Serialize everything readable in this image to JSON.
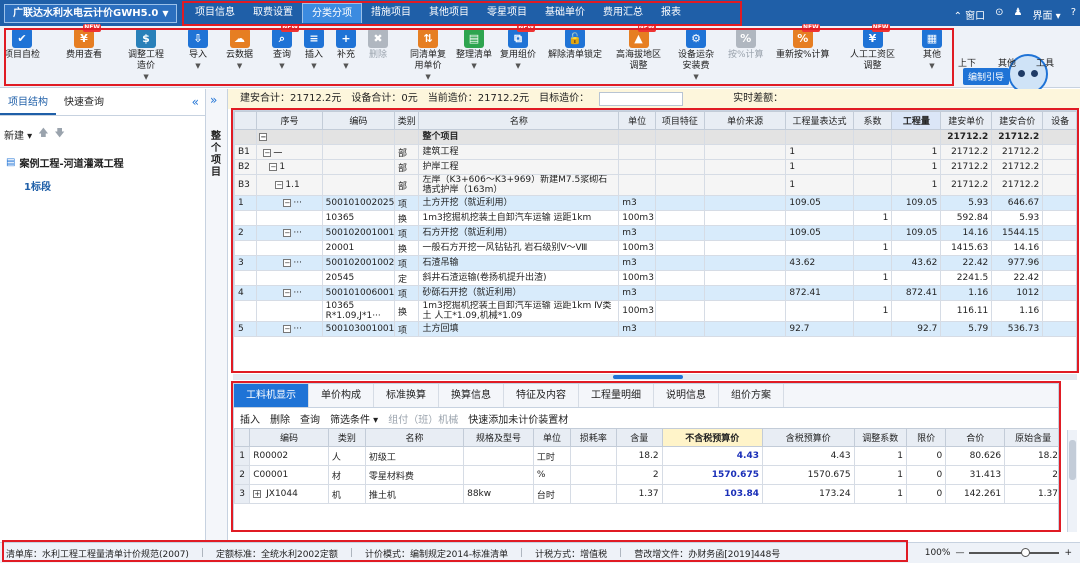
{
  "titlebar": {
    "app_name": "广联达水利水电云计价GWH5.0",
    "tabs": [
      "项目信息",
      "取费设置",
      "分类分项",
      "措施项目",
      "其他项目",
      "零星项目",
      "基础单价",
      "费用汇总",
      "报表"
    ],
    "active_tab": "分类分项",
    "right": [
      "窗口",
      "界面"
    ]
  },
  "ribbon": {
    "buttons": [
      {
        "label": "项目自检",
        "color": "#1f73d6",
        "glyph": "✔"
      },
      {
        "label": "费用查看",
        "color": "#e67e22",
        "glyph": "¥",
        "new": true
      },
      {
        "label": "调整工程\n造价",
        "color": "#2980b9",
        "glyph": "$",
        "caret": true
      },
      {
        "label": "导入",
        "color": "#1f73d6",
        "glyph": "⇩",
        "caret": true
      },
      {
        "label": "云数据",
        "color": "#e67e22",
        "glyph": "☁",
        "caret": true
      },
      {
        "label": "查询",
        "color": "#1f73d6",
        "glyph": "⌕",
        "caret": true,
        "new": true
      },
      {
        "label": "插入",
        "color": "#1f73d6",
        "glyph": "≡",
        "caret": true
      },
      {
        "label": "补充",
        "color": "#1f73d6",
        "glyph": "+",
        "caret": true
      },
      {
        "label": "删除",
        "color": "#b0b7c0",
        "glyph": "✖",
        "disabled": true
      },
      {
        "label": "同清单复\n用单价",
        "color": "#e67e22",
        "glyph": "⇅",
        "caret": true
      },
      {
        "label": "整理清单",
        "color": "#2ea44f",
        "glyph": "▤",
        "caret": true
      },
      {
        "label": "复用组价",
        "color": "#1f73d6",
        "glyph": "⧉",
        "caret": true,
        "new": true
      },
      {
        "label": "解除清单锁定",
        "color": "#1f73d6",
        "glyph": "🔓"
      },
      {
        "label": "高海拔地区\n调整",
        "color": "#e67e22",
        "glyph": "▲",
        "new": true
      },
      {
        "label": "设备运杂\n安装费",
        "color": "#1f73d6",
        "glyph": "⚙",
        "caret": true
      },
      {
        "label": "按%计算",
        "color": "#b0b7c0",
        "glyph": "%",
        "disabled": true
      },
      {
        "label": "重新按%计算",
        "color": "#e67e22",
        "glyph": "%",
        "new": true
      },
      {
        "label": "人工工资区\n调整",
        "color": "#1f73d6",
        "glyph": "¥",
        "new": true
      },
      {
        "label": "其他",
        "color": "#1f73d6",
        "glyph": "▦",
        "caret": true
      },
      {
        "label": "上下",
        "color": "#1f73d6",
        "glyph": "⇅"
      },
      {
        "label": "其他",
        "color": "#1f73d6",
        "glyph": "▦"
      },
      {
        "label": "工具",
        "color": "#1f73d6",
        "glyph": "✎",
        "caret": true
      }
    ],
    "guide_label": "编制引导"
  },
  "left_panel": {
    "tabs": [
      "项目结构",
      "快速查询"
    ],
    "toolbar_new": "新建",
    "tree_root": "案例工程-河道灌溉工程",
    "tree_child": "1标段"
  },
  "vertical_label": "整个项目",
  "summary": {
    "build_total": "建安合计：21712.2元",
    "equip_total": "设备合计：0元",
    "current_price": "当前造价：21712.2元",
    "target_label": "目标造价：",
    "realtime_diff": "实时差额："
  },
  "main_grid": {
    "headers": [
      "序号",
      "编码",
      "类别",
      "名称",
      "单位",
      "项目特征",
      "单价来源",
      "工程量表达式",
      "系数",
      "工程量",
      "建安单价",
      "建安合价",
      "设备"
    ],
    "highlight_header": "工程量",
    "rows": [
      {
        "kind": "root",
        "no": "",
        "tree": "−",
        "code": "",
        "type": "",
        "name": "整个项目",
        "unit": "",
        "expr": "",
        "coef": "",
        "qty": "",
        "price": "21712.2",
        "total": "21712.2"
      },
      {
        "kind": "section",
        "no": "B1",
        "tree": "− 一",
        "code": "",
        "type": "部",
        "name": "建筑工程",
        "unit": "",
        "expr": "1",
        "coef": "",
        "qty": "1",
        "price": "21712.2",
        "total": "21712.2"
      },
      {
        "kind": "section",
        "no": "B2",
        "tree": "− 1",
        "code": "",
        "type": "部",
        "name": "护岸工程",
        "unit": "",
        "expr": "1",
        "coef": "",
        "qty": "1",
        "price": "21712.2",
        "total": "21712.2"
      },
      {
        "kind": "section",
        "no": "B3",
        "tree": "− 1.1",
        "code": "",
        "type": "部",
        "name": "左岸（K3+606～K3+969）新建M7.5浆砌石墙式护岸（163m）",
        "unit": "",
        "expr": "1",
        "coef": "",
        "qty": "1",
        "price": "21712.2",
        "total": "21712.2"
      },
      {
        "kind": "item",
        "no": "1",
        "tree": "− ···",
        "code": "500101002025",
        "type": "项",
        "name": "土方开挖（就近利用）",
        "unit": "m3",
        "expr": "109.05",
        "coef": "",
        "qty": "109.05",
        "price": "5.93",
        "total": "646.67"
      },
      {
        "kind": "sub",
        "no": "",
        "tree": "",
        "code": "10365",
        "type": "换",
        "name": "1m3挖掘机挖装土自卸汽车运输 运距1km",
        "unit": "100m3",
        "expr": "",
        "coef": "1",
        "qty": "",
        "price": "592.84",
        "total": "5.93"
      },
      {
        "kind": "item",
        "no": "2",
        "tree": "− ···",
        "code": "500102001001",
        "type": "项",
        "name": "石方开挖（就近利用）",
        "unit": "m3",
        "expr": "109.05",
        "coef": "",
        "qty": "109.05",
        "price": "14.16",
        "total": "1544.15"
      },
      {
        "kind": "sub",
        "no": "",
        "tree": "",
        "code": "20001",
        "type": "换",
        "name": "一般石方开挖一风钻钻孔 岩石级别V～Ⅷ",
        "unit": "100m3",
        "expr": "",
        "coef": "1",
        "qty": "",
        "price": "1415.63",
        "total": "14.16"
      },
      {
        "kind": "item",
        "no": "3",
        "tree": "− ···",
        "code": "500102001002",
        "type": "项",
        "name": "石渣吊输",
        "unit": "m3",
        "expr": "43.62",
        "coef": "",
        "qty": "43.62",
        "price": "22.42",
        "total": "977.96"
      },
      {
        "kind": "sub",
        "no": "",
        "tree": "",
        "code": "20545",
        "type": "定",
        "name": "斜井石渣运输(卷扬机提升出渣)",
        "unit": "100m3",
        "expr": "",
        "coef": "1",
        "qty": "",
        "price": "2241.5",
        "total": "22.42"
      },
      {
        "kind": "item",
        "no": "4",
        "tree": "− ···",
        "code": "500101006001",
        "type": "项",
        "name": "砂砾石开挖（就近利用）",
        "unit": "m3",
        "expr": "872.41",
        "coef": "",
        "qty": "872.41",
        "price": "1.16",
        "total": "1012"
      },
      {
        "kind": "sub",
        "no": "",
        "tree": "",
        "code": "10365\nR*1.09,J*1···",
        "type": "换",
        "name": "1m3挖掘机挖装土自卸汽车运输 运距1km Ⅳ类土 人工*1.09,机械*1.09",
        "unit": "100m3",
        "expr": "",
        "coef": "1",
        "qty": "",
        "price": "116.11",
        "total": "1.16"
      },
      {
        "kind": "item",
        "no": "5",
        "tree": "− ···",
        "code": "500103001001",
        "type": "项",
        "name": "土方回填",
        "unit": "m3",
        "expr": "92.7",
        "coef": "",
        "qty": "92.7",
        "price": "5.79",
        "total": "536.73"
      }
    ]
  },
  "bottom_panel": {
    "tabs": [
      "工料机显示",
      "单价构成",
      "标准换算",
      "换算信息",
      "特征及内容",
      "工程量明细",
      "说明信息",
      "组价方案"
    ],
    "active_tab": "工料机显示",
    "toolbar": [
      "插入",
      "删除",
      "查询",
      "筛选条件",
      "组付（班）机械",
      "快速添加未计价装置材"
    ],
    "headers": [
      "编码",
      "类别",
      "名称",
      "规格及型号",
      "单位",
      "损耗率",
      "含量",
      "不含税预算价",
      "含税预算价",
      "调整系数",
      "限价",
      "合价",
      "原始含量"
    ],
    "rows": [
      {
        "no": "1",
        "code": "R00002",
        "type": "人",
        "name": "初级工",
        "spec": "",
        "unit": "工时",
        "loss": "",
        "content": "18.2",
        "price": "4.43",
        "taxprice": "4.43",
        "coef": "1",
        "limit": "0",
        "total": "80.626",
        "orig": "18.2"
      },
      {
        "no": "2",
        "code": "C00001",
        "type": "材",
        "name": "零星材料费",
        "spec": "",
        "unit": "%",
        "loss": "",
        "content": "2",
        "price": "1570.675",
        "taxprice": "1570.675",
        "coef": "1",
        "limit": "0",
        "total": "31.413",
        "orig": "2"
      },
      {
        "no": "3",
        "code": "JX1044",
        "type": "机",
        "name": "推土机",
        "spec": "88kw",
        "unit": "台时",
        "loss": "",
        "content": "1.37",
        "price": "103.84",
        "taxprice": "173.24",
        "coef": "1",
        "limit": "0",
        "total": "142.261",
        "orig": "1.37"
      }
    ]
  },
  "statusbar": {
    "items": [
      "清单库：水利工程工程量清单计价规范(2007)",
      "定额标准：全统水利2002定额",
      "计价模式：编制规定2014-标准清单",
      "计税方式：增值税",
      "营改增文件：办财务函[2019]448号"
    ],
    "zoom": "100%"
  }
}
